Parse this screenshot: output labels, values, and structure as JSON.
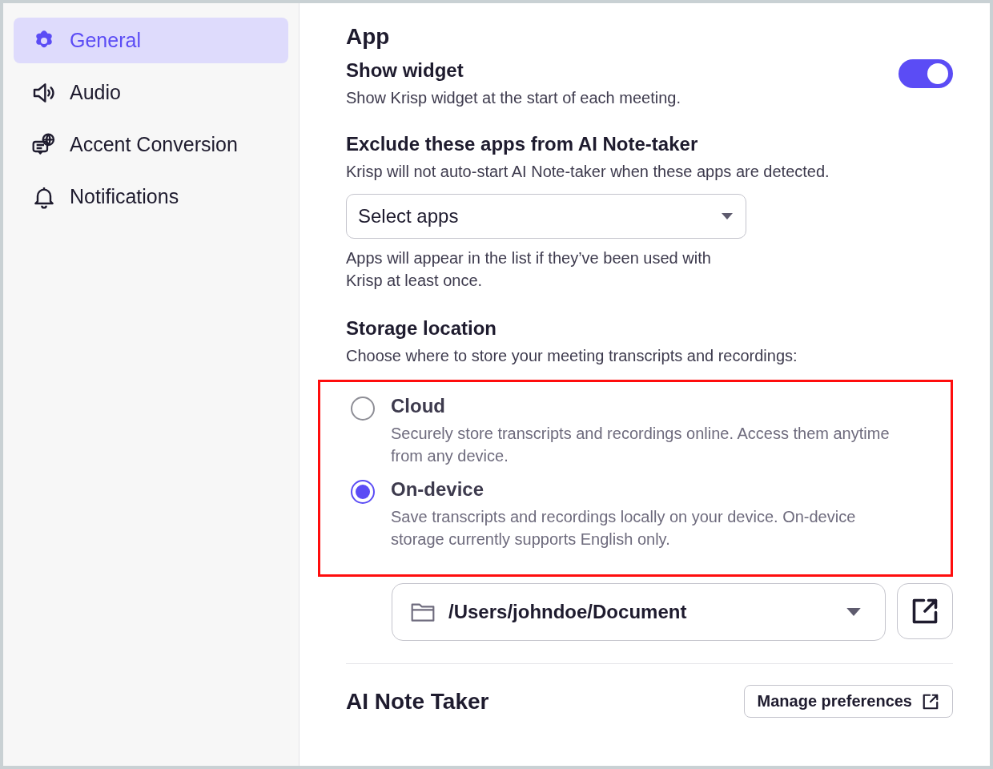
{
  "sidebar": {
    "items": [
      {
        "label": "General",
        "kind": "gear",
        "selected": true
      },
      {
        "label": "Audio",
        "kind": "speaker",
        "selected": false
      },
      {
        "label": "Accent Conversion",
        "kind": "chat-globe",
        "selected": false
      },
      {
        "label": "Notifications",
        "kind": "bell",
        "selected": false
      }
    ]
  },
  "section_title": "App",
  "show_widget": {
    "title": "Show widget",
    "description": "Show Krisp widget at the start of each meeting.",
    "on": true
  },
  "exclude_apps": {
    "title": "Exclude these apps from AI Note-taker",
    "description": "Krisp will not auto-start AI Note-taker when these apps are detected.",
    "placeholder": "Select apps",
    "hint": "Apps will appear in the list if they’ve been used with Krisp at least once."
  },
  "storage": {
    "title": "Storage location",
    "description": "Choose where to store your meeting transcripts and recordings:",
    "highlighted": true,
    "options": [
      {
        "label": "Cloud",
        "description": "Securely store transcripts and recordings online. Access them anytime from any device.",
        "selected": false
      },
      {
        "label": "On-device",
        "description": "Save transcripts and recordings locally on your device. On-device storage currently supports English only.",
        "selected": true
      }
    ],
    "path": "/Users/johndoe/Document"
  },
  "ai_note_taker": {
    "title": "AI Note Taker",
    "button": "Manage preferences"
  }
}
